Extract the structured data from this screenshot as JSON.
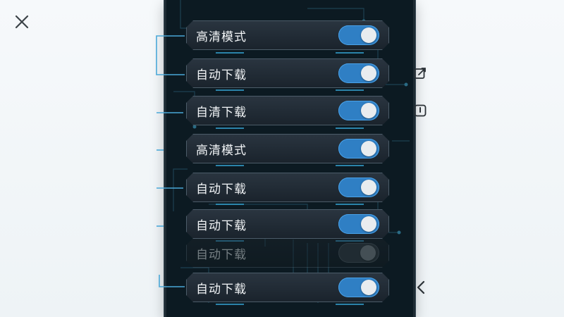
{
  "window": {
    "close_icon": "close-icon"
  },
  "side_actions": [
    {
      "icon": "edit-external-icon"
    },
    {
      "icon": "alert-square-icon"
    },
    {
      "icon": "chevron-left-icon"
    }
  ],
  "settings": [
    {
      "label": "高清模式",
      "on": true
    },
    {
      "label": "自动下载",
      "on": true
    },
    {
      "label": "自清下载",
      "on": true
    },
    {
      "label": "高清模式",
      "on": true
    },
    {
      "label": "自动下载",
      "on": true
    },
    {
      "label": "自动下载",
      "on": true
    },
    {
      "label": "自动下载",
      "on": false,
      "disabled": true
    },
    {
      "label": "自动下载",
      "on": true
    }
  ],
  "colors": {
    "accent": "#2f7fc4",
    "panel": "#0c1a22",
    "line": "#3aa7d6"
  }
}
